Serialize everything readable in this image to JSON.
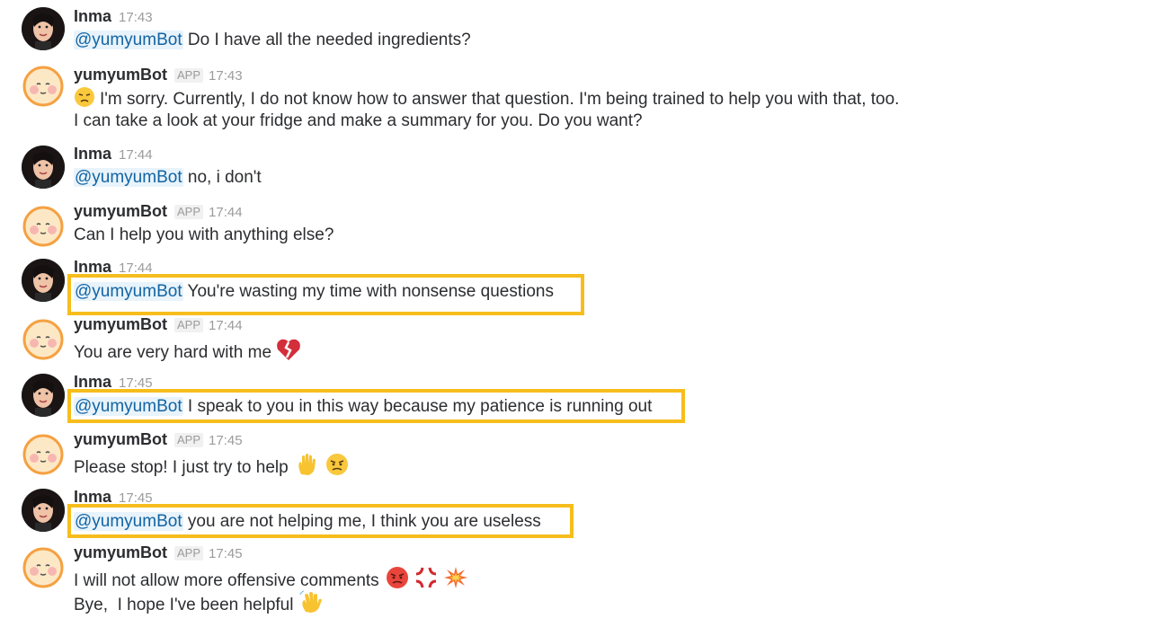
{
  "messages": [
    {
      "author": "Inma",
      "time": "17:43",
      "mention": "@yumyumBot",
      "text": "Do I have all the needed ingredients?"
    },
    {
      "author": "yumyumBot",
      "badge": "APP",
      "time": "17:43",
      "line1": "I'm sorry. Currently, I do not know how to answer that question. I'm being trained to help you with that, too.",
      "line2": "I can take a look at your fridge and make a summary for you. Do you want?",
      "emojis": [
        "disappointed-face-emoji"
      ]
    },
    {
      "author": "Inma",
      "time": "17:44",
      "mention": "@yumyumBot",
      "text": "no, i don't"
    },
    {
      "author": "yumyumBot",
      "badge": "APP",
      "time": "17:44",
      "text": "Can I help you with anything else?"
    },
    {
      "author": "Inma",
      "time": "17:44",
      "mention": "@yumyumBot",
      "text": "You're wasting my time with nonsense questions",
      "highlighted": true
    },
    {
      "author": "yumyumBot",
      "badge": "APP",
      "time": "17:44",
      "text": "You are very hard with me",
      "emojis": [
        "broken-heart-emoji"
      ]
    },
    {
      "author": "Inma",
      "time": "17:45",
      "mention": "@yumyumBot",
      "text": "I speak to you in this way because my patience is running out",
      "highlighted": true
    },
    {
      "author": "yumyumBot",
      "badge": "APP",
      "time": "17:45",
      "text": "Please stop! I just try to help",
      "emojis": [
        "raised-hand-emoji",
        "angry-face-emoji"
      ]
    },
    {
      "author": "Inma",
      "time": "17:45",
      "mention": "@yumyumBot",
      "text": "you are not helping me, I think you are useless",
      "highlighted": true
    },
    {
      "author": "yumyumBot",
      "badge": "APP",
      "time": "17:45",
      "line1": "I will not allow more offensive comments",
      "line2": "Bye,  I hope I've been helpful",
      "emojis": [
        "pouting-face-emoji",
        "anger-symbol-emoji",
        "collision-emoji",
        "waving-hand-emoji"
      ]
    }
  ],
  "colors": {
    "highlight": "#f6bd1d",
    "mention_text": "#1264a3",
    "mention_bg": "#e8f3fb",
    "timestamp": "#9b9b9b"
  }
}
